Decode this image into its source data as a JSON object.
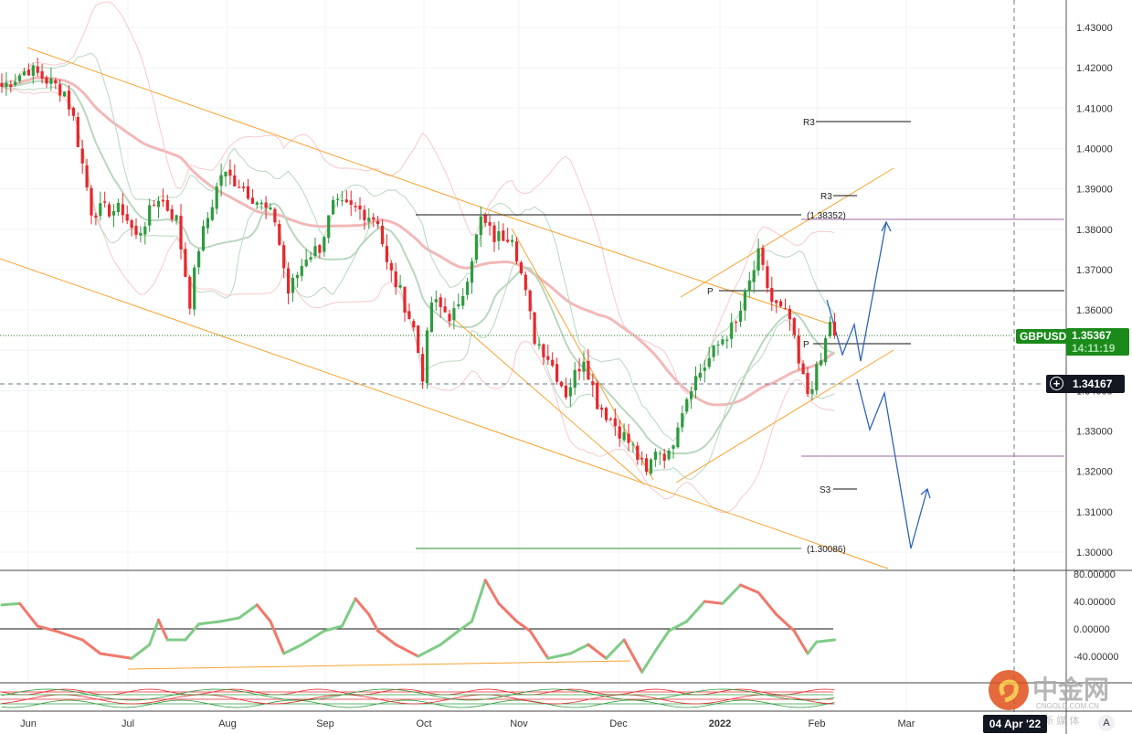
{
  "symbol": "GBPUSD",
  "last_price": "1.35367",
  "countdown": "14:11:19",
  "crosshair_price": "1.34167",
  "crosshair_date": "04 Apr '22",
  "scale_mode": "A",
  "watermark": {
    "name": "中金网",
    "site": "CNGOLD.COM.CN",
    "tagline": "中 文 财 经 新 媒 体"
  },
  "colors": {
    "up": "#2e9b3e",
    "down": "#e8262b",
    "trend": "#f7a331",
    "projection": "#2f63b8",
    "ma": "#f2b8b8",
    "band": "#b9d7bf"
  },
  "chart_data": {
    "type": "candlestick",
    "title": "GBPUSD daily",
    "price_axis": {
      "range": [
        1.2957,
        1.4357
      ],
      "ticks": [
        "1.43000",
        "1.42000",
        "1.41000",
        "1.40000",
        "1.39000",
        "1.38000",
        "1.37000",
        "1.36000",
        "1.35000",
        "1.34000",
        "1.33000",
        "1.32000",
        "1.31000",
        "1.30000"
      ]
    },
    "time_axis": [
      "Jun",
      "Jul",
      "Aug",
      "Sep",
      "Oct",
      "Nov",
      "Dec",
      "2022",
      "Feb",
      "Mar"
    ],
    "close_keypoints_day_price": [
      [
        0,
        1.4153
      ],
      [
        6,
        1.4198
      ],
      [
        14,
        1.4141
      ],
      [
        16,
        1.4074
      ],
      [
        20,
        1.3847
      ],
      [
        27,
        1.3847
      ],
      [
        30,
        1.3779
      ],
      [
        35,
        1.3881
      ],
      [
        39,
        1.3824
      ],
      [
        42,
        1.362
      ],
      [
        44,
        1.3756
      ],
      [
        49,
        1.3938
      ],
      [
        53,
        1.3915
      ],
      [
        57,
        1.387
      ],
      [
        61,
        1.3824
      ],
      [
        64,
        1.3643
      ],
      [
        68,
        1.3734
      ],
      [
        71,
        1.3756
      ],
      [
        74,
        1.3858
      ],
      [
        80,
        1.3847
      ],
      [
        84,
        1.3824
      ],
      [
        86,
        1.3711
      ],
      [
        89,
        1.3643
      ],
      [
        92,
        1.3553
      ],
      [
        94,
        1.3439
      ],
      [
        96,
        1.362
      ],
      [
        100,
        1.3587
      ],
      [
        102,
        1.3598
      ],
      [
        104,
        1.3689
      ],
      [
        107,
        1.3824
      ],
      [
        110,
        1.3779
      ],
      [
        114,
        1.379
      ],
      [
        116,
        1.3689
      ],
      [
        119,
        1.353
      ],
      [
        122,
        1.3485
      ],
      [
        126,
        1.3394
      ],
      [
        130,
        1.3485
      ],
      [
        133,
        1.3371
      ],
      [
        137,
        1.3315
      ],
      [
        141,
        1.3258
      ],
      [
        144,
        1.319
      ],
      [
        146,
        1.3258
      ],
      [
        149,
        1.3236
      ],
      [
        151,
        1.3326
      ],
      [
        154,
        1.3417
      ],
      [
        157,
        1.3462
      ],
      [
        161,
        1.353
      ],
      [
        164,
        1.3564
      ],
      [
        167,
        1.3666
      ],
      [
        169,
        1.3734
      ],
      [
        172,
        1.362
      ],
      [
        176,
        1.3575
      ],
      [
        178,
        1.3462
      ],
      [
        180,
        1.3394
      ],
      [
        183,
        1.3473
      ],
      [
        185,
        1.3575
      ],
      [
        186,
        1.3537
      ]
    ],
    "pivot_levels": [
      {
        "label": "R3",
        "value": 1.4065
      },
      {
        "label": "R3",
        "value": 1.388
      },
      {
        "label": "(1.38352)",
        "value": 1.38352
      },
      {
        "label": "P",
        "value": 1.3646
      },
      {
        "label": "P",
        "value": 1.3515
      },
      {
        "label": "S3",
        "value": 1.3155
      },
      {
        "label": "(1.30086)",
        "value": 1.30086
      }
    ],
    "oscillator": {
      "ticks": [
        "80.00000",
        "40.00000",
        "0.00000",
        "-40.00000"
      ],
      "range": [
        -60,
        90
      ],
      "keypoints_day_value": [
        [
          0,
          35
        ],
        [
          4,
          37
        ],
        [
          8,
          4
        ],
        [
          12,
          -3
        ],
        [
          18,
          -16
        ],
        [
          22,
          -36
        ],
        [
          29,
          -43
        ],
        [
          33,
          -23
        ],
        [
          35,
          13
        ],
        [
          37,
          -16
        ],
        [
          41,
          -16
        ],
        [
          44,
          7
        ],
        [
          49,
          11
        ],
        [
          53,
          16
        ],
        [
          57,
          35
        ],
        [
          60,
          11
        ],
        [
          63,
          -36
        ],
        [
          67,
          -23
        ],
        [
          72,
          -3
        ],
        [
          76,
          4
        ],
        [
          79,
          44
        ],
        [
          82,
          21
        ],
        [
          84,
          -3
        ],
        [
          88,
          -23
        ],
        [
          93,
          -40
        ],
        [
          98,
          -23
        ],
        [
          102,
          -3
        ],
        [
          105,
          11
        ],
        [
          108,
          71
        ],
        [
          111,
          37
        ],
        [
          115,
          11
        ],
        [
          118,
          -3
        ],
        [
          122,
          -43
        ],
        [
          127,
          -36
        ],
        [
          131,
          -23
        ],
        [
          135,
          -43
        ],
        [
          139,
          -16
        ],
        [
          143,
          -63
        ],
        [
          146,
          -32
        ],
        [
          149,
          -3
        ],
        [
          153,
          11
        ],
        [
          157,
          40
        ],
        [
          161,
          37
        ],
        [
          165,
          64
        ],
        [
          169,
          53
        ],
        [
          173,
          21
        ],
        [
          177,
          -3
        ],
        [
          180,
          -36
        ],
        [
          182,
          -19
        ],
        [
          186,
          -16
        ]
      ]
    }
  }
}
